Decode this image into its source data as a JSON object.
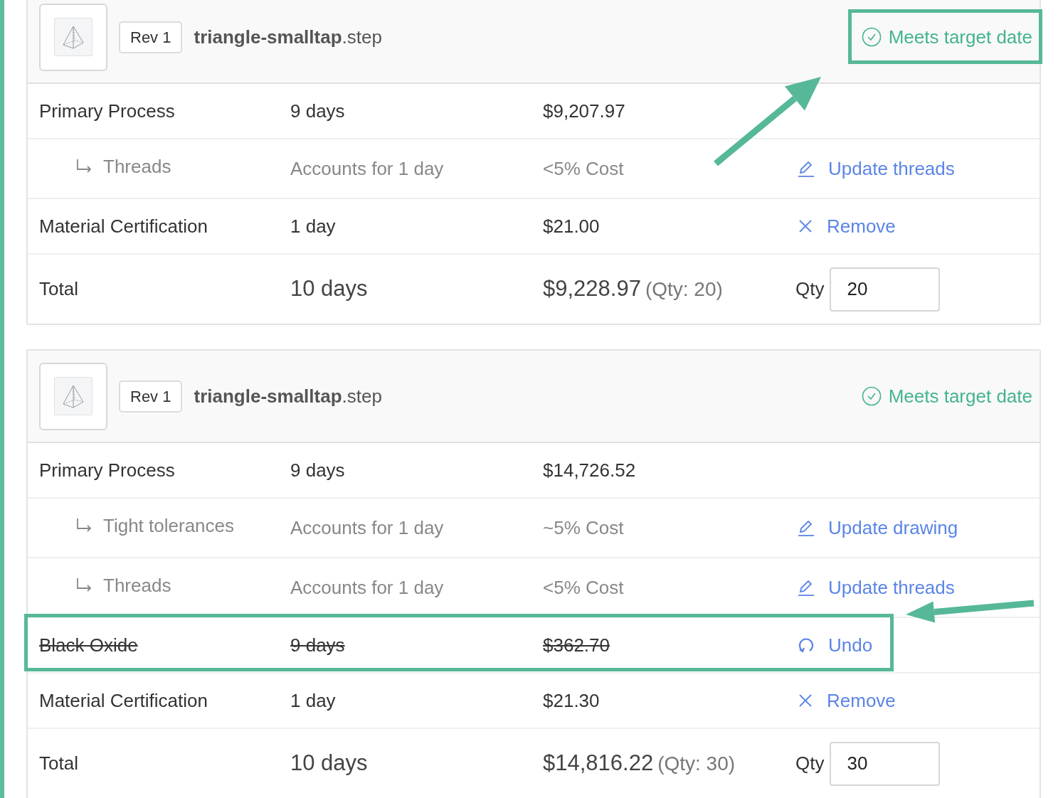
{
  "cards": [
    {
      "revision": "Rev 1",
      "file_name": "triangle-smalltap",
      "file_ext": ".step",
      "status": {
        "label": "Meets target date",
        "highlighted": true,
        "arrow": true
      },
      "rows": [
        {
          "kind": "process",
          "label": "Primary Process",
          "days": "9 days",
          "cost": "$9,207.97"
        },
        {
          "kind": "sub",
          "label": "Threads",
          "days": "Accounts for 1 day",
          "cost": "<5% Cost",
          "action": {
            "kind": "edit",
            "label": "Update threads"
          }
        },
        {
          "kind": "process",
          "label": "Material Certification",
          "days": "1 day",
          "cost": "$21.00",
          "action": {
            "kind": "remove",
            "label": "Remove"
          }
        }
      ],
      "total": {
        "label": "Total",
        "days": "10 days",
        "cost": "$9,228.97",
        "qty_note": "(Qty: 20)",
        "qty_label": "Qty",
        "qty": "20"
      }
    },
    {
      "revision": "Rev 1",
      "file_name": "triangle-smalltap",
      "file_ext": ".step",
      "status": {
        "label": "Meets target date",
        "highlighted": false,
        "arrow": false
      },
      "rows": [
        {
          "kind": "process",
          "label": "Primary Process",
          "days": "9 days",
          "cost": "$14,726.52"
        },
        {
          "kind": "sub",
          "label": "Tight tolerances",
          "days": "Accounts for 1 day",
          "cost": "~5% Cost",
          "action": {
            "kind": "edit",
            "label": "Update drawing"
          }
        },
        {
          "kind": "sub",
          "label": "Threads",
          "days": "Accounts for 1 day",
          "cost": "<5% Cost",
          "action": {
            "kind": "edit",
            "label": "Update threads"
          }
        },
        {
          "kind": "removed",
          "label": "Black Oxide",
          "days": "9 days",
          "cost": "$362.70",
          "highlighted": true,
          "arrow": true,
          "action": {
            "kind": "undo",
            "label": "Undo"
          }
        },
        {
          "kind": "process",
          "label": "Material Certification",
          "days": "1 day",
          "cost": "$21.30",
          "action": {
            "kind": "remove",
            "label": "Remove"
          }
        }
      ],
      "total": {
        "label": "Total",
        "days": "10 days",
        "cost": "$14,816.22",
        "qty_note": "(Qty: 30)",
        "qty_label": "Qty",
        "qty": "30"
      }
    }
  ]
}
